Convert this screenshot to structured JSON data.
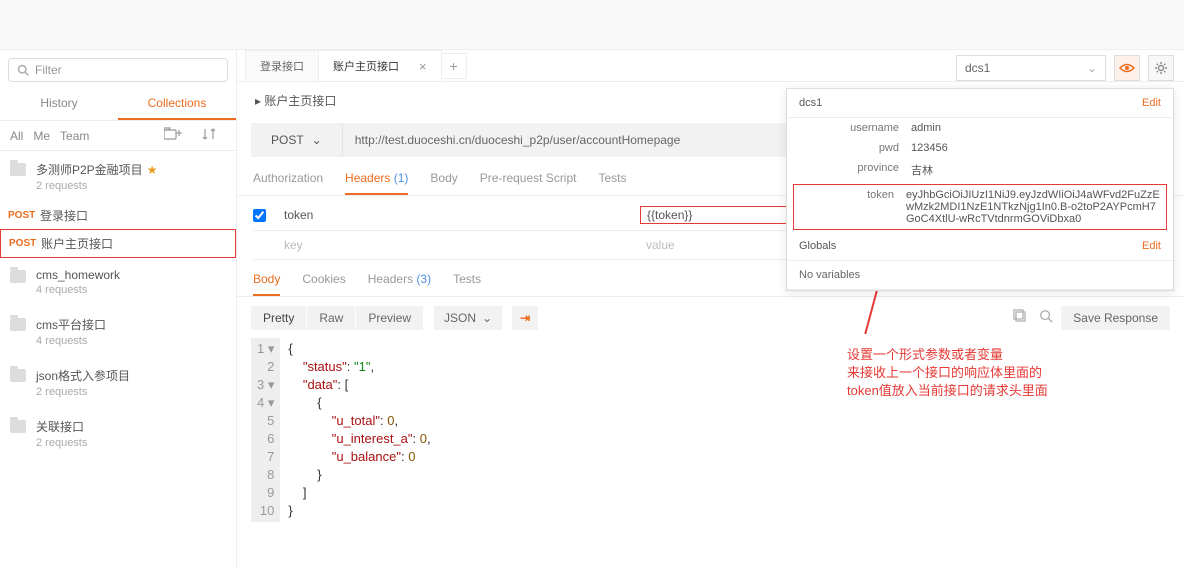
{
  "filter": {
    "placeholder": "Filter"
  },
  "sidebar_tabs": {
    "history": "History",
    "collections": "Collections"
  },
  "scopes": {
    "all": "All",
    "me": "Me",
    "team": "Team"
  },
  "collections": [
    {
      "name": "多测师P2P金融项目",
      "sub": "2 requests",
      "star": true,
      "requests": [
        {
          "method": "POST",
          "name": "登录接口",
          "hl": false
        },
        {
          "method": "POST",
          "name": "账户主页接口",
          "hl": true
        }
      ]
    },
    {
      "name": "cms_homework",
      "sub": "4 requests"
    },
    {
      "name": "cms平台接口",
      "sub": "4 requests"
    },
    {
      "name": "json格式入参项目",
      "sub": "2 requests"
    },
    {
      "name": "关联接口",
      "sub": "2 requests"
    }
  ],
  "tabs": [
    {
      "label": "登录接口",
      "active": false
    },
    {
      "label": "账户主页接口",
      "active": true
    }
  ],
  "breadcrumb": "▸ 账户主页接口",
  "request": {
    "method": "POST",
    "url": "http://test.duoceshi.cn/duoceshi_p2p/user/accountHomepage",
    "tabs": {
      "auth": "Authorization",
      "headers": "Headers",
      "headers_count": "(1)",
      "body": "Body",
      "pre": "Pre-request Script",
      "tests": "Tests"
    },
    "headers": [
      {
        "checked": true,
        "key": "token",
        "value": "{{token}}"
      }
    ],
    "ph": {
      "key": "key",
      "value": "value"
    }
  },
  "response": {
    "tabs": {
      "body": "Body",
      "cookies": "Cookies",
      "headers": "Headers",
      "headers_count": "(3)",
      "tests": "Tests"
    },
    "views": {
      "pretty": "Pretty",
      "raw": "Raw",
      "preview": "Preview"
    },
    "format": "JSON",
    "save": "Save Response",
    "code_lines": [
      "{",
      "    \"status\": \"1\",",
      "    \"data\": [",
      "        {",
      "            \"u_total\": 0,",
      "            \"u_interest_a\": 0,",
      "            \"u_balance\": 0",
      "        }",
      "    ]",
      "}"
    ]
  },
  "env": {
    "selected": "dcs1",
    "name": "dcs1",
    "edit": "Edit",
    "vars": [
      {
        "k": "username",
        "v": "admin"
      },
      {
        "k": "pwd",
        "v": "123456"
      },
      {
        "k": "province",
        "v": "吉林"
      },
      {
        "k": "token",
        "v": "eyJhbGciOiJIUzI1NiJ9.eyJzdWIiOiJ4aWFvd2FuZzEwMzk2MDI1NzE1NTkzNjg1In0.B-o2toP2AYPcmH7GoC4XtlU-wRcTVtdnrmGOViDbxa0",
        "hl": true
      }
    ],
    "globals": "Globals",
    "no_vars": "No variables"
  },
  "annotation": {
    "l1": "设置一个形式参数或者变量",
    "l2": "来接收上一个接口的响应体里面的",
    "l3": "token值放入当前接口的请求头里面"
  }
}
